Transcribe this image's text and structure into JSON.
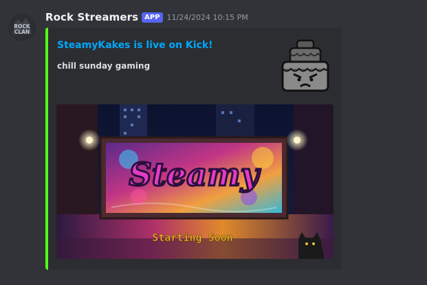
{
  "author": {
    "name": "Rock Streamers",
    "badge": "APP",
    "timestamp": "11/24/2024 10:15 PM",
    "avatar_text_top": "ROCK",
    "avatar_text_bottom": "CLAN"
  },
  "embed": {
    "accent_color": "#53fc18",
    "title": "SteamyKakes is live on Kick!",
    "description": "chill sunday gaming",
    "thumbnail_icon": "angry-cake-icon",
    "image": {
      "graffiti_text": "Steamy",
      "caption": "Starting Soon"
    }
  }
}
